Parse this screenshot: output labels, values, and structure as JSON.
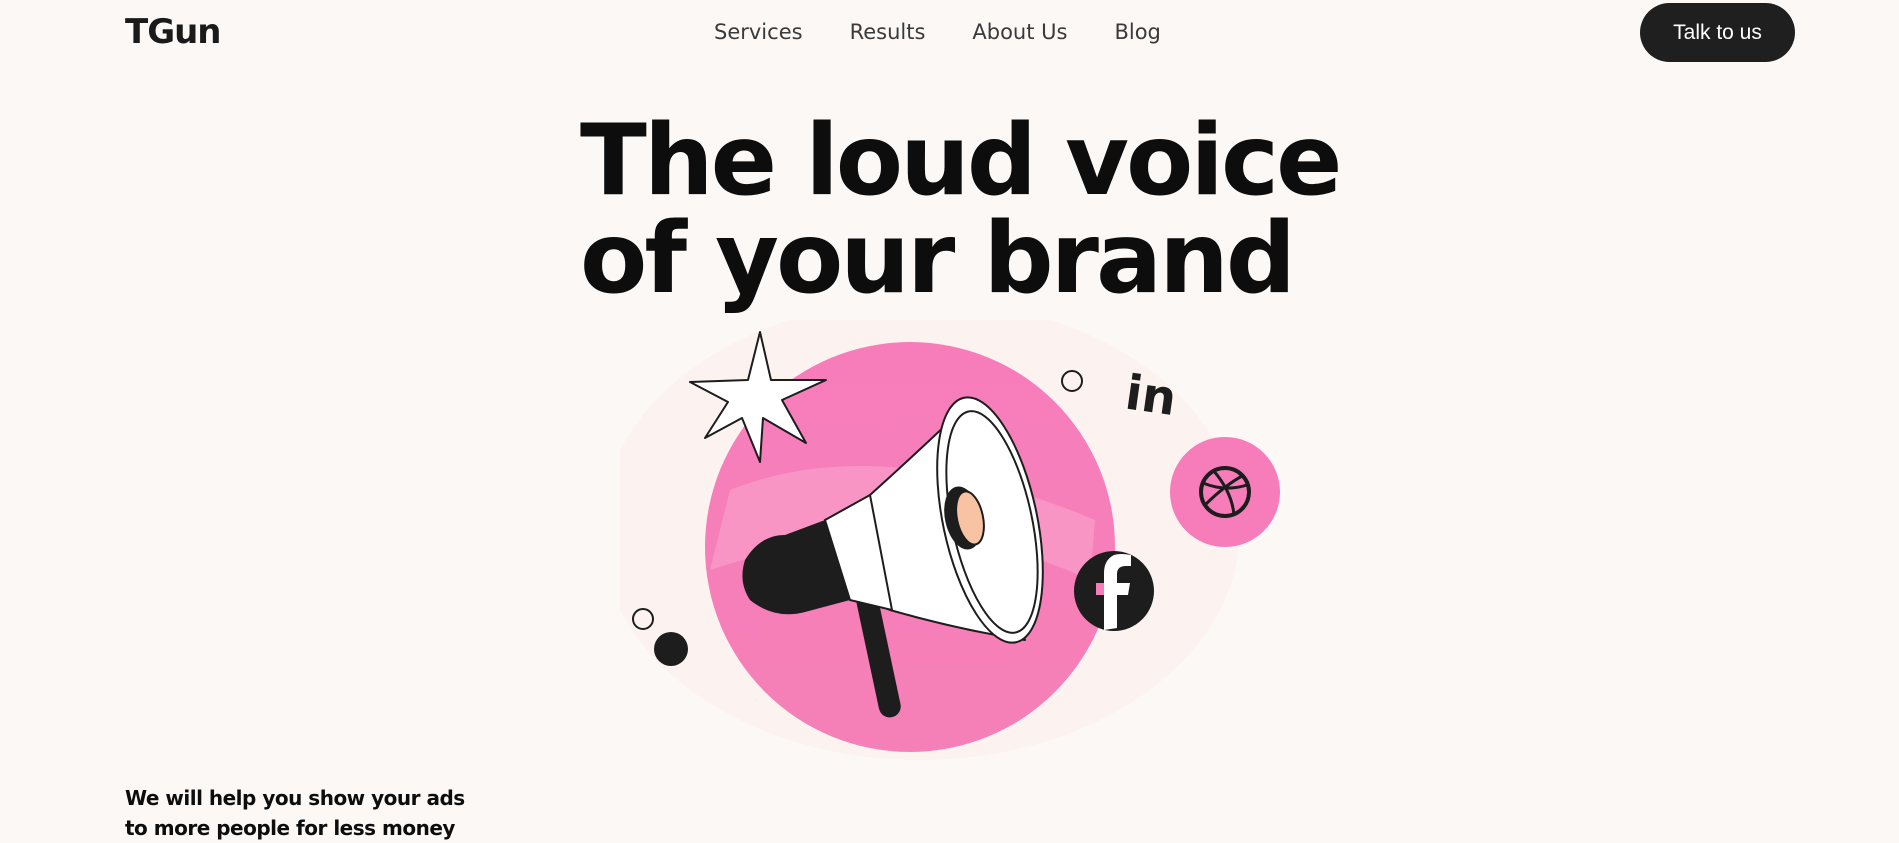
{
  "brand": {
    "logo": "TGun"
  },
  "nav": {
    "items": [
      "Services",
      "Results",
      "About Us",
      "Blog"
    ]
  },
  "cta": {
    "label": "Talk to us"
  },
  "hero": {
    "title_line1": "The loud voice",
    "title_line2": "of your brand",
    "tagline_line1": "We will help you show your ads",
    "tagline_line2": "to more people for less money"
  },
  "illustration": {
    "icons": [
      "megaphone-icon",
      "star-burst-icon",
      "linkedin-icon",
      "dribbble-icon",
      "facebook-icon"
    ],
    "colors": {
      "accent": "#f77fb9",
      "dark": "#1d1d1d",
      "cream": "#fcf8f6",
      "mouth": "#f7c3a3"
    }
  }
}
